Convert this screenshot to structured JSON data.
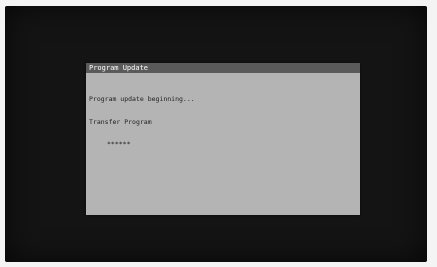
{
  "dialog": {
    "title": "Program Update",
    "lines": [
      "Program update beginning...",
      "Transfer Program",
      "******"
    ]
  },
  "colors": {
    "screen": "#141414",
    "dialog_background": "#b4b4b4",
    "title_bar": "#5a5a5a",
    "title_text": "#ffffff",
    "body_text": "#202020"
  }
}
